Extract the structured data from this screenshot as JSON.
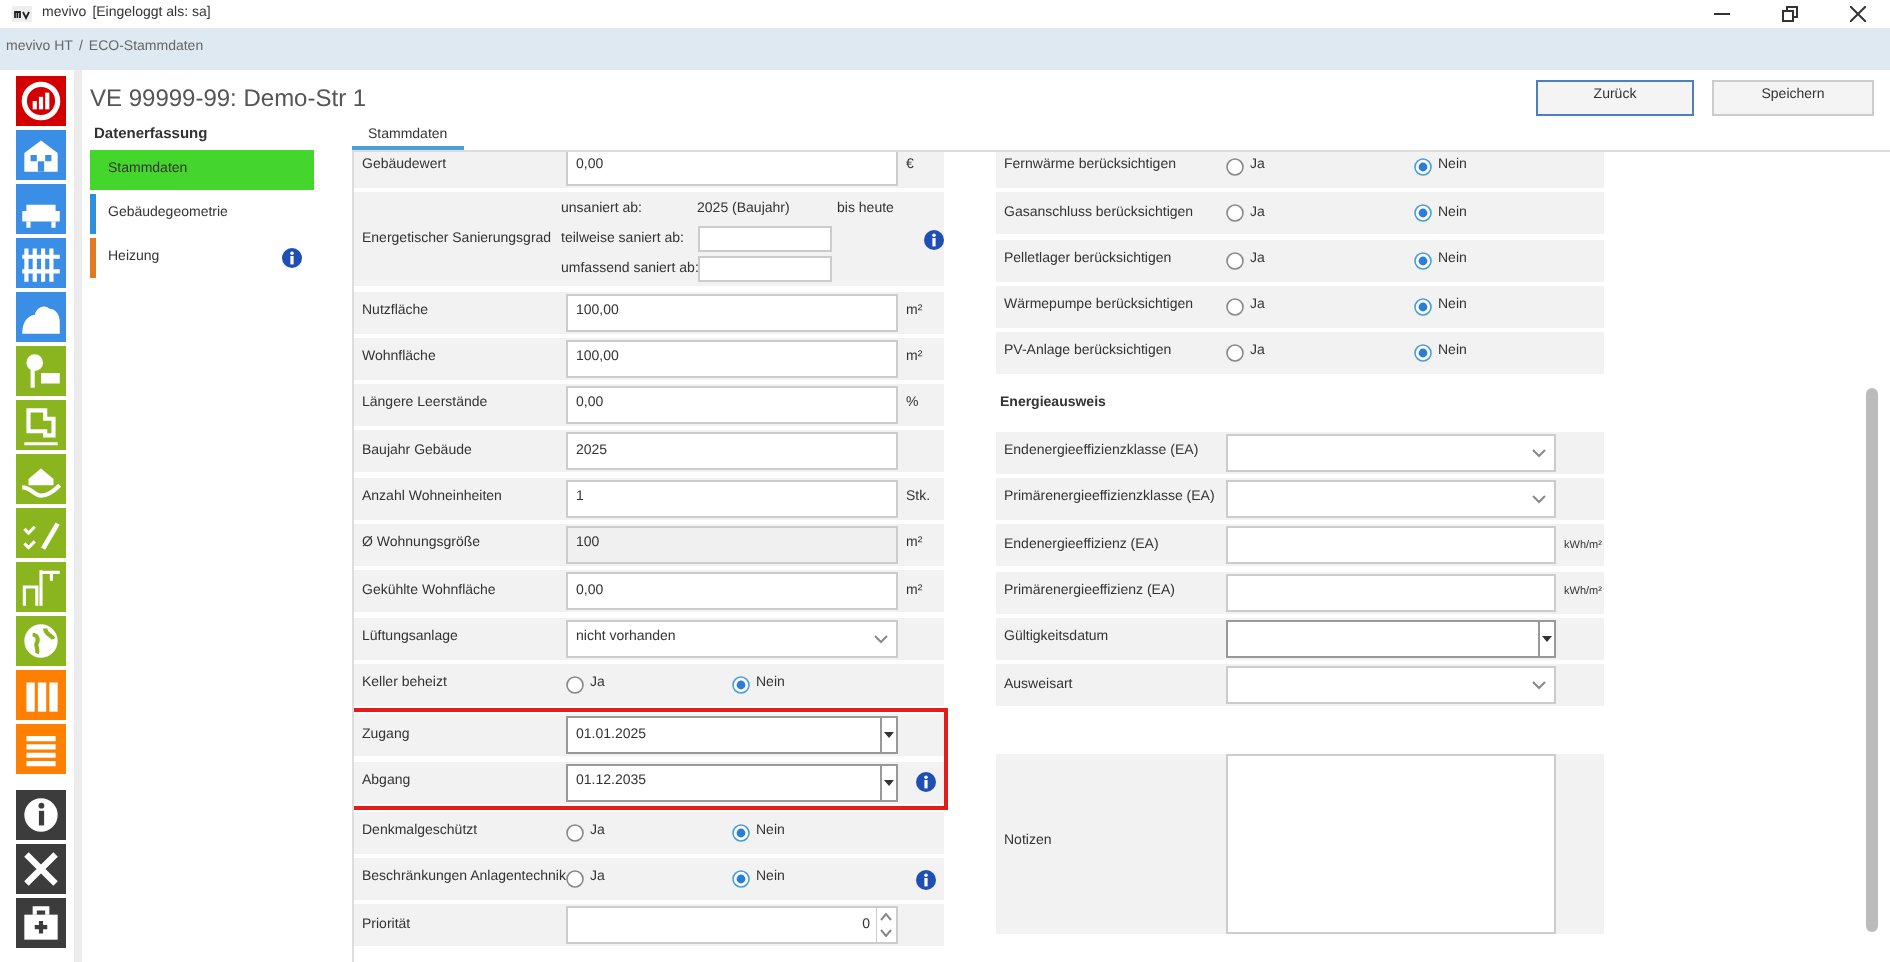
{
  "window": {
    "app": "mevivo",
    "title": "[Eingeloggt als: sa]"
  },
  "breadcrumb": [
    "mevivo HT",
    "/",
    "ECO-Stammdaten"
  ],
  "sidebar": [
    {
      "color": "#d40000"
    },
    {
      "color": "#3a8ee6"
    },
    {
      "color": "#3a8ee6"
    },
    {
      "color": "#3a8ee6"
    },
    {
      "color": "#3a8ee6"
    },
    {
      "color": "#8ab51e"
    },
    {
      "color": "#8ab51e"
    },
    {
      "color": "#8ab51e"
    },
    {
      "color": "#8ab51e"
    },
    {
      "color": "#8ab51e"
    },
    {
      "color": "#8ab51e"
    },
    {
      "color": "#ff7f00"
    },
    {
      "color": "#ff7f00"
    },
    {
      "color": "#3c3c3c"
    },
    {
      "color": "#3c3c3c"
    },
    {
      "color": "#3c3c3c"
    }
  ],
  "page_title": "VE 99999-99: Demo-Str 1",
  "buttons": [
    {
      "label": "Zurück",
      "selected": true
    },
    {
      "label": "Speichern",
      "selected": false
    }
  ],
  "nav": {
    "heading": "Datenerfassung",
    "items": [
      {
        "label": "Stammdaten",
        "selected": true,
        "color": "#44d62c",
        "info": false
      },
      {
        "label": "Gebäudegeometrie",
        "selected": false,
        "color": "#2f8fd8",
        "info": false
      },
      {
        "label": "Heizung",
        "selected": false,
        "color": "#e07b24",
        "info": true
      }
    ]
  },
  "tabs": [
    {
      "label": "Stammdaten",
      "selected": true
    }
  ],
  "left_form": [
    {
      "kind": "input",
      "label": "Gebäudewert",
      "value": "0,00",
      "unit": "€"
    },
    {
      "kind": "renovation",
      "label": "Energetischer Sanierungsgrad",
      "info": true,
      "lines": [
        {
          "kind": "text",
          "label": "unsaniert ab:",
          "value": "2025 (Baujahr)",
          "suffix": "bis heute"
        },
        {
          "kind": "field",
          "label": "teilweise saniert ab:"
        },
        {
          "kind": "field",
          "label": "umfassend saniert ab:"
        }
      ]
    },
    {
      "kind": "input",
      "label": "Nutzfläche",
      "value": "100,00",
      "unit": "m²"
    },
    {
      "kind": "input",
      "label": "Wohnfläche",
      "value": "100,00",
      "unit": "m²"
    },
    {
      "kind": "input",
      "label": "Längere Leerstände",
      "value": "0,00",
      "unit": "%"
    },
    {
      "kind": "input",
      "label": "Baujahr Gebäude",
      "value": "2025"
    },
    {
      "kind": "input",
      "label": "Anzahl Wohneinheiten",
      "value": "1",
      "unit": "Stk."
    },
    {
      "kind": "input",
      "label": "Ø Wohnungsgröße",
      "value": "100",
      "unit": "m²",
      "disabled": true
    },
    {
      "kind": "input",
      "label": "Gekühlte Wohnfläche",
      "value": "0,00",
      "unit": "m²"
    },
    {
      "kind": "select",
      "label": "Lüftungsanlage",
      "value": "nicht vorhanden"
    },
    {
      "kind": "radio",
      "label": "Keller beheizt",
      "options": [
        {
          "label": "Ja",
          "selected": false
        },
        {
          "label": "Nein",
          "selected": true
        }
      ]
    },
    {
      "kind": "highlight",
      "rows": [
        {
          "kind": "date",
          "label": "Zugang",
          "value": "01.01.2025"
        },
        {
          "kind": "date",
          "label": "Abgang",
          "value": "01.12.2035",
          "info": true
        }
      ]
    },
    {
      "kind": "radio",
      "label": "Denkmalgeschützt",
      "options": [
        {
          "label": "Ja",
          "selected": false
        },
        {
          "label": "Nein",
          "selected": true
        }
      ]
    },
    {
      "kind": "radio",
      "label": "Beschränkungen Anlagentechnik",
      "info": true,
      "options": [
        {
          "label": "Ja",
          "selected": false
        },
        {
          "label": "Nein",
          "selected": true
        }
      ]
    },
    {
      "kind": "spin",
      "label": "Priorität",
      "value": "0"
    }
  ],
  "right_form": [
    {
      "kind": "radio",
      "label": "Fernwärme berücksichtigen",
      "options": [
        {
          "label": "Ja",
          "selected": false
        },
        {
          "label": "Nein",
          "selected": true
        }
      ]
    },
    {
      "kind": "radio",
      "label": "Gasanschluss berücksichtigen",
      "options": [
        {
          "label": "Ja",
          "selected": false
        },
        {
          "label": "Nein",
          "selected": true
        }
      ]
    },
    {
      "kind": "radio",
      "label": "Pelletlager berücksichtigen",
      "options": [
        {
          "label": "Ja",
          "selected": false
        },
        {
          "label": "Nein",
          "selected": true
        }
      ]
    },
    {
      "kind": "radio",
      "label": "Wärmepumpe berücksichtigen",
      "options": [
        {
          "label": "Ja",
          "selected": false
        },
        {
          "label": "Nein",
          "selected": true
        }
      ]
    },
    {
      "kind": "radio",
      "label": "PV-Anlage berücksichtigen",
      "options": [
        {
          "label": "Ja",
          "selected": false
        },
        {
          "label": "Nein",
          "selected": true
        }
      ]
    },
    {
      "kind": "heading",
      "label": "Energieausweis"
    },
    {
      "kind": "select",
      "label": "Endenergieeffizienzklasse (EA)"
    },
    {
      "kind": "select",
      "label": "Primärenergieeffizienzklasse (EA)"
    },
    {
      "kind": "input",
      "label": "Endenergieeffizienz (EA)",
      "unit": "kWh/m²"
    },
    {
      "kind": "input",
      "label": "Primärenergieeffizienz (EA)",
      "unit": "kWh/m²"
    },
    {
      "kind": "date",
      "label": "Gültigkeitsdatum"
    },
    {
      "kind": "select",
      "label": "Ausweisart"
    },
    {
      "kind": "notes",
      "label": "Notizen"
    }
  ]
}
